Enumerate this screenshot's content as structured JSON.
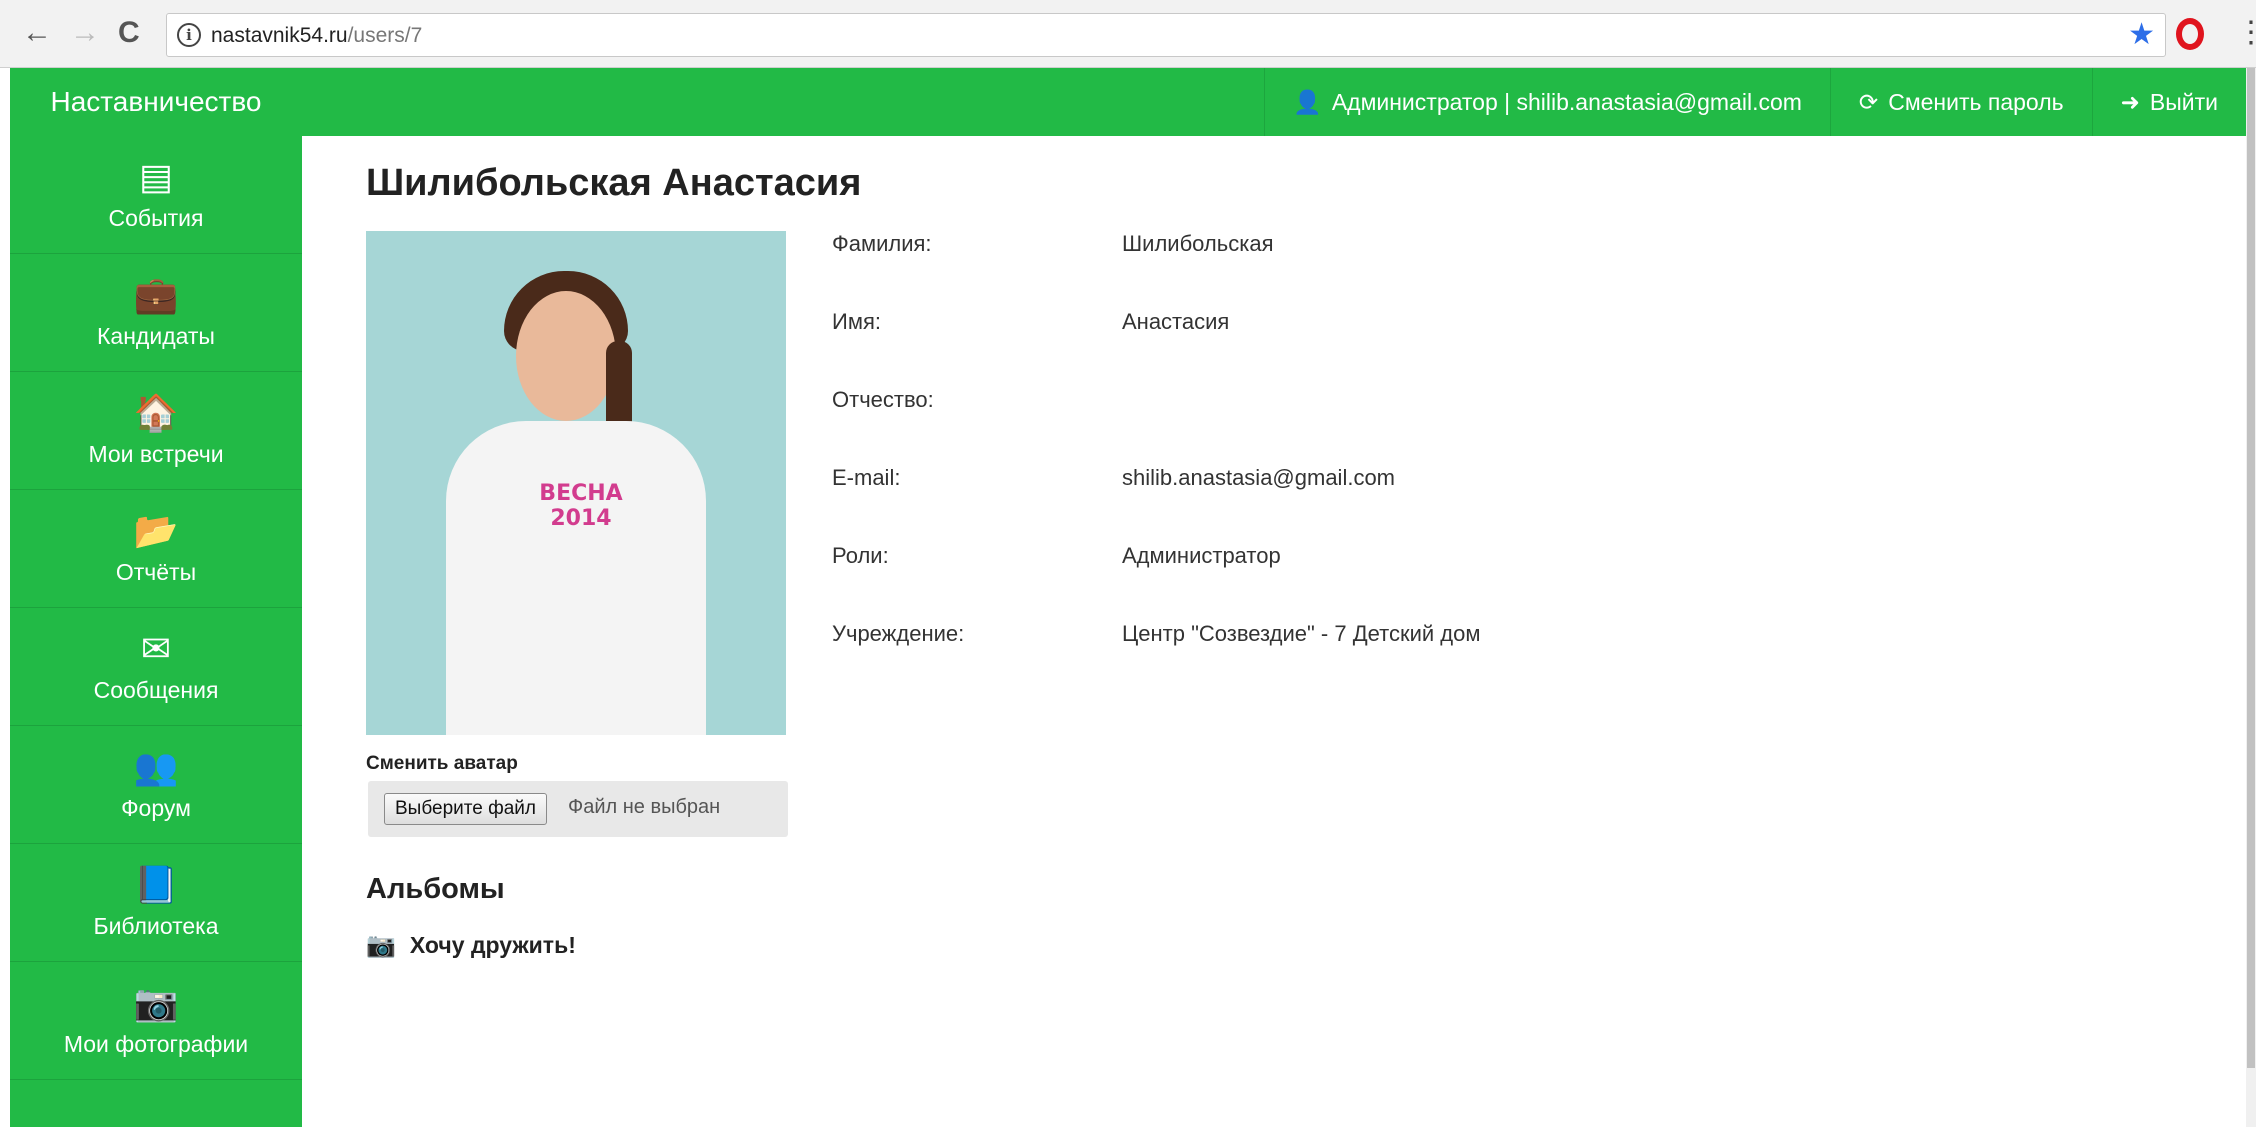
{
  "browser": {
    "back_icon": "←",
    "forward_icon": "→",
    "reload_icon": "C",
    "url_host": "nastavnik54.ru",
    "url_path": "/users/7",
    "info_icon": "i",
    "star_icon": "★",
    "menu_icon": "⋮"
  },
  "header": {
    "brand": "Наставничество",
    "user": "Администратор | shilib.anastasia@gmail.com",
    "change_password": "Сменить пароль",
    "logout": "Выйти",
    "user_icon": "👤",
    "refresh_icon": "⟳",
    "logout_icon": "➜"
  },
  "sidebar": {
    "items": [
      {
        "label": "События",
        "icon": "▤",
        "icon_name": "newspaper-icon"
      },
      {
        "label": "Кандидаты",
        "icon": "💼",
        "icon_name": "briefcase-icon"
      },
      {
        "label": "Мои встречи",
        "icon": "🏠",
        "icon_name": "home-icon"
      },
      {
        "label": "Отчёты",
        "icon": "📂",
        "icon_name": "folder-open-icon"
      },
      {
        "label": "Сообщения",
        "icon": "✉",
        "icon_name": "envelope-icon"
      },
      {
        "label": "Форум",
        "icon": "👥",
        "icon_name": "users-icon"
      },
      {
        "label": "Библиотека",
        "icon": "📘",
        "icon_name": "book-icon"
      },
      {
        "label": "Мои фотографии",
        "icon": "📷",
        "icon_name": "photo-icon"
      }
    ]
  },
  "profile": {
    "title": "Шилибольская Анастасия",
    "photo_text": "ВЕСНА 2014",
    "fields": [
      {
        "label": "Фамилия:",
        "value": "Шилибольская"
      },
      {
        "label": "Имя:",
        "value": "Анастасия"
      },
      {
        "label": "Отчество:",
        "value": ""
      },
      {
        "label": "E-mail:",
        "value": "shilib.anastasia@gmail.com"
      },
      {
        "label": "Роли:",
        "value": "Администратор"
      },
      {
        "label": "Учреждение:",
        "value": "Центр \"Созвездие\" - 7 Детский дом"
      }
    ],
    "change_avatar_label": "Сменить аватар",
    "choose_file_button": "Выберите файл",
    "file_status": "Файл не выбран"
  },
  "albums": {
    "title": "Альбомы",
    "camera_icon": "📷",
    "items": [
      {
        "name": "Хочу дружить!"
      }
    ]
  }
}
